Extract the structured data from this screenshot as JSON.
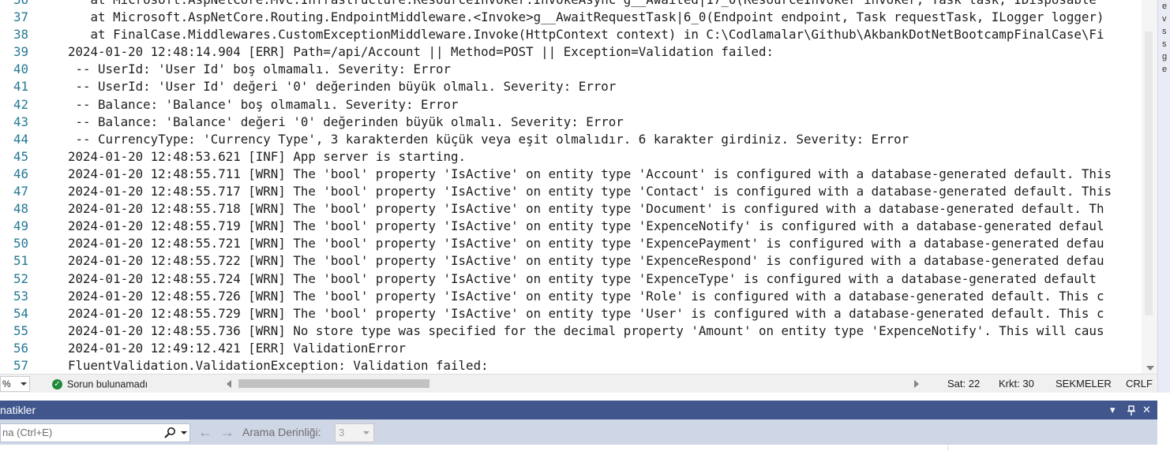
{
  "editor": {
    "lines": [
      {
        "num": "36",
        "text": "   at Microsoft.AspNetCore.Mvc.Infrastructure.ResourceInvoker.InvokeAsync g__Awaited|17_0(ResourceInvoker invoker, Task task, IDisposable"
      },
      {
        "num": "37",
        "text": "   at Microsoft.AspNetCore.Routing.EndpointMiddleware.<Invoke>g__AwaitRequestTask|6_0(Endpoint endpoint, Task requestTask, ILogger logger)"
      },
      {
        "num": "38",
        "text": "   at FinalCase.Middlewares.CustomExceptionMiddleware.Invoke(HttpContext context) in C:\\Codlamalar\\Github\\AkbankDotNetBootcampFinalCase\\Fi"
      },
      {
        "num": "39",
        "text": "2024-01-20 12:48:14.904 [ERR] Path=/api/Account || Method=POST || Exception=Validation failed:"
      },
      {
        "num": "40",
        "text": " -- UserId: 'User Id' boş olmamalı. Severity: Error"
      },
      {
        "num": "41",
        "text": " -- UserId: 'User Id' değeri '0' değerinden büyük olmalı. Severity: Error"
      },
      {
        "num": "42",
        "text": " -- Balance: 'Balance' boş olmamalı. Severity: Error"
      },
      {
        "num": "43",
        "text": " -- Balance: 'Balance' değeri '0' değerinden büyük olmalı. Severity: Error"
      },
      {
        "num": "44",
        "text": " -- CurrencyType: 'Currency Type', 3 karakterden küçük veya eşit olmalıdır. 6 karakter girdiniz. Severity: Error"
      },
      {
        "num": "45",
        "text": "2024-01-20 12:48:53.621 [INF] App server is starting."
      },
      {
        "num": "46",
        "text": "2024-01-20 12:48:55.711 [WRN] The 'bool' property 'IsActive' on entity type 'Account' is configured with a database-generated default. This"
      },
      {
        "num": "47",
        "text": "2024-01-20 12:48:55.717 [WRN] The 'bool' property 'IsActive' on entity type 'Contact' is configured with a database-generated default. This"
      },
      {
        "num": "48",
        "text": "2024-01-20 12:48:55.718 [WRN] The 'bool' property 'IsActive' on entity type 'Document' is configured with a database-generated default. Th"
      },
      {
        "num": "49",
        "text": "2024-01-20 12:48:55.719 [WRN] The 'bool' property 'IsActive' on entity type 'ExpenceNotify' is configured with a database-generated defaul"
      },
      {
        "num": "50",
        "text": "2024-01-20 12:48:55.721 [WRN] The 'bool' property 'IsActive' on entity type 'ExpencePayment' is configured with a database-generated defau"
      },
      {
        "num": "51",
        "text": "2024-01-20 12:48:55.722 [WRN] The 'bool' property 'IsActive' on entity type 'ExpenceRespond' is configured with a database-generated defau"
      },
      {
        "num": "52",
        "text": "2024-01-20 12:48:55.724 [WRN] The 'bool' property 'IsActive' on entity type 'ExpenceType' is configured with a database-generated default"
      },
      {
        "num": "53",
        "text": "2024-01-20 12:48:55.726 [WRN] The 'bool' property 'IsActive' on entity type 'Role' is configured with a database-generated default. This c"
      },
      {
        "num": "54",
        "text": "2024-01-20 12:48:55.729 [WRN] The 'bool' property 'IsActive' on entity type 'User' is configured with a database-generated default. This c"
      },
      {
        "num": "55",
        "text": "2024-01-20 12:48:55.736 [WRN] No store type was specified for the decimal property 'Amount' on entity type 'ExpenceNotify'. This will caus"
      },
      {
        "num": "56",
        "text": "2024-01-20 12:49:12.421 [ERR] ValidationError"
      },
      {
        "num": "57",
        "text": "FluentValidation.ValidationException: Validation failed:"
      }
    ]
  },
  "statusbar": {
    "zoom": "%",
    "issues": "Sorun bulunamadı",
    "line": "Sat: 22",
    "char": "Krkt: 30",
    "indent": "SEKMELER",
    "eol": "CRLF"
  },
  "toolwindow": {
    "title": "natikler",
    "search_placeholder": "na (Ctrl+E)",
    "depth_label": "Arama Derinliği:",
    "depth_value": "3",
    "controls": {
      "dropdown": "▾",
      "pin": "⊥",
      "close": "✕"
    }
  },
  "rightpanel": {
    "chars": [
      "e",
      "v",
      "s",
      "s",
      "g",
      "e"
    ]
  },
  "colors": {
    "title_bar": "#40568d",
    "toolbar": "#cfd6e5",
    "line_number": "#237893",
    "ok_icon": "#1e8a3a"
  }
}
